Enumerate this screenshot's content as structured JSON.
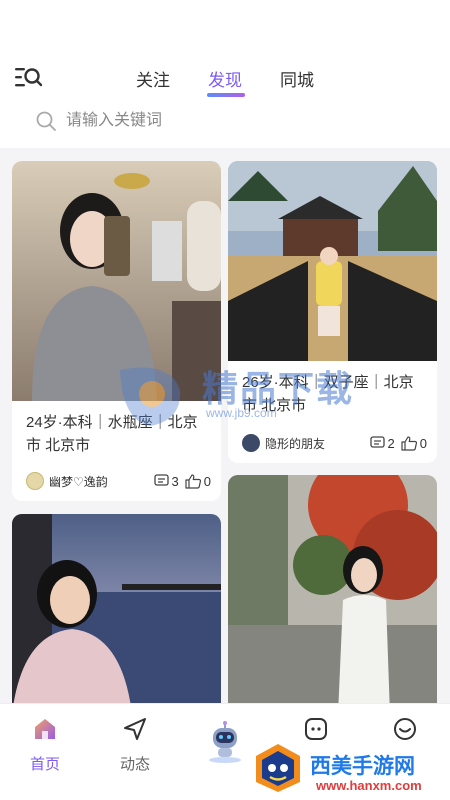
{
  "header": {
    "tabs": [
      {
        "label": "关注",
        "active": false
      },
      {
        "label": "发现",
        "active": true
      },
      {
        "label": "同城",
        "active": false
      }
    ],
    "menu_icon": "menu-search-icon",
    "accent_color": "#7c5cf0"
  },
  "search": {
    "placeholder": "请输入关键词",
    "value": ""
  },
  "feed": {
    "cards": [
      {
        "text": "24岁·本科｜水瓶座｜北京市 北京市",
        "username": "幽梦♡逸韵",
        "comments": "3",
        "likes": "0"
      },
      {
        "text": "26岁·本科｜双子座｜北京市 北京市",
        "username": "隐形的朋友",
        "comments": "2",
        "likes": "0"
      },
      {
        "text": "",
        "username": "",
        "comments": "",
        "likes": ""
      },
      {
        "text": "",
        "username": "",
        "comments": "",
        "likes": ""
      }
    ]
  },
  "bottom_nav": {
    "items": [
      {
        "label": "首页",
        "icon": "home-icon",
        "active": true
      },
      {
        "label": "动态",
        "icon": "send-icon",
        "active": false
      },
      {
        "label": "",
        "icon": "robot-icon",
        "active": false
      },
      {
        "label": "",
        "icon": "message-icon",
        "active": false
      },
      {
        "label": "",
        "icon": "smile-icon",
        "active": false
      }
    ]
  },
  "watermarks": {
    "center_title": "精品下载",
    "center_url": "www.jb9.com",
    "bottom_title": "西美手游网",
    "bottom_url": "www.hanxm.com"
  }
}
